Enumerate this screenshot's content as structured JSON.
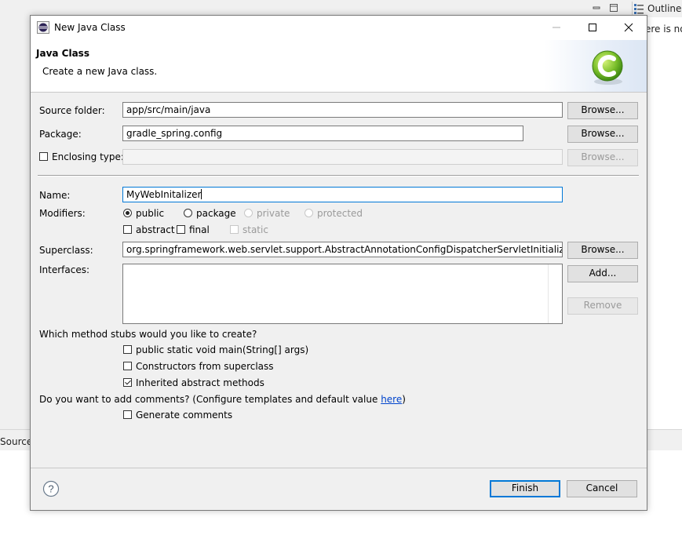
{
  "ide": {
    "outline_label": "Outline",
    "outline_message": "ere is no",
    "source_tab": "Source"
  },
  "dialog": {
    "title": "New Java Class",
    "banner": {
      "heading": "Java Class",
      "description": "Create a new Java class."
    },
    "source_folder": {
      "label": "Source folder:",
      "value": "app/src/main/java",
      "browse": "Browse..."
    },
    "package": {
      "label": "Package:",
      "value": "gradle_spring.config",
      "browse": "Browse..."
    },
    "enclosing_type": {
      "label": "Enclosing type:",
      "checked": false,
      "value": "",
      "browse": "Browse..."
    },
    "name": {
      "label": "Name:",
      "value": "MyWebInitalizer"
    },
    "modifiers": {
      "label": "Modifiers:",
      "access": [
        "public",
        "package",
        "private",
        "protected"
      ],
      "selected": "public",
      "flags": [
        "abstract",
        "final",
        "static"
      ]
    },
    "superclass": {
      "label": "Superclass:",
      "value": "org.springframework.web.servlet.support.AbstractAnnotationConfigDispatcherServletInitializer",
      "browse": "Browse..."
    },
    "interfaces": {
      "label": "Interfaces:",
      "add": "Add...",
      "remove": "Remove"
    },
    "stubs": {
      "question": "Which method stubs would you like to create?",
      "options": [
        {
          "label": "public static void main(String[] args)",
          "checked": false
        },
        {
          "label": "Constructors from superclass",
          "checked": false
        },
        {
          "label": "Inherited abstract methods",
          "checked": true
        }
      ]
    },
    "comments": {
      "question": "Do you want to add comments? (Configure templates and default value ",
      "link": "here",
      "question_end": ")",
      "option": {
        "label": "Generate comments",
        "checked": false
      }
    },
    "buttons": {
      "finish": "Finish",
      "cancel": "Cancel"
    },
    "help_icon": "?"
  }
}
